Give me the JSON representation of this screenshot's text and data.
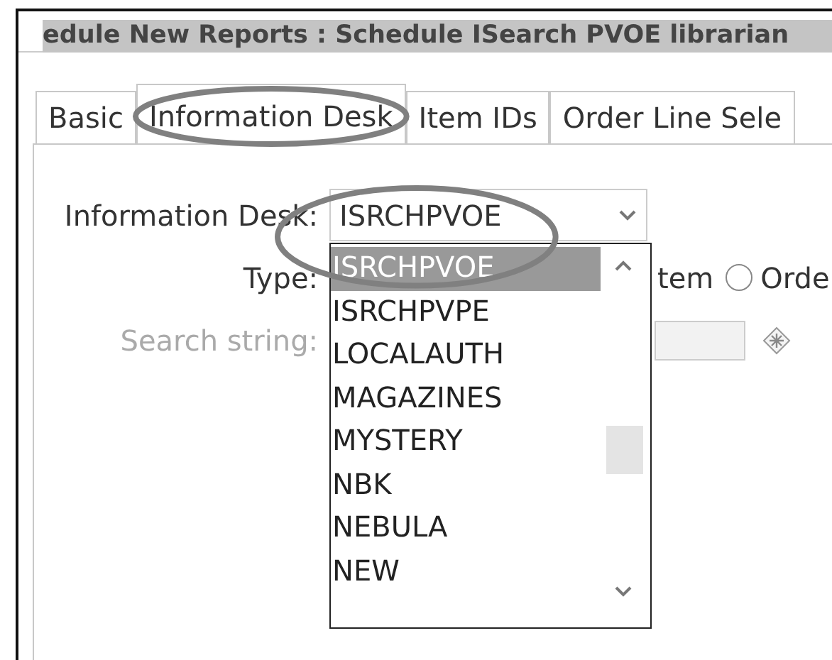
{
  "window": {
    "title": "edule New Reports : Schedule ISearch PVOE librarian"
  },
  "tabs": [
    {
      "label": "Basic",
      "selected": false
    },
    {
      "label": "Information Desk",
      "selected": true
    },
    {
      "label": "Item IDs",
      "selected": false
    },
    {
      "label": "Order Line Sele",
      "selected": false
    }
  ],
  "form": {
    "information_desk": {
      "label": "Information Desk:",
      "value": "ISRCHPVOE",
      "expanded": true,
      "options": [
        {
          "label": "ISRCHPVOE",
          "selected": true
        },
        {
          "label": "ISRCHPVPE",
          "selected": false
        },
        {
          "label": "LOCALAUTH",
          "selected": false
        },
        {
          "label": "MAGAZINES",
          "selected": false
        },
        {
          "label": "MYSTERY",
          "selected": false
        },
        {
          "label": "NBK",
          "selected": false
        },
        {
          "label": "NEBULA",
          "selected": false
        },
        {
          "label": "NEW",
          "selected": false
        }
      ]
    },
    "type": {
      "label": "Type:",
      "options": [
        {
          "label": "tem",
          "kind": "label"
        },
        {
          "label": "Orde",
          "kind": "radio",
          "selected": false
        }
      ]
    },
    "search_string": {
      "label": "Search string:",
      "disabled": true
    }
  },
  "annotations": [
    {
      "kind": "oval"
    },
    {
      "kind": "oval"
    }
  ]
}
